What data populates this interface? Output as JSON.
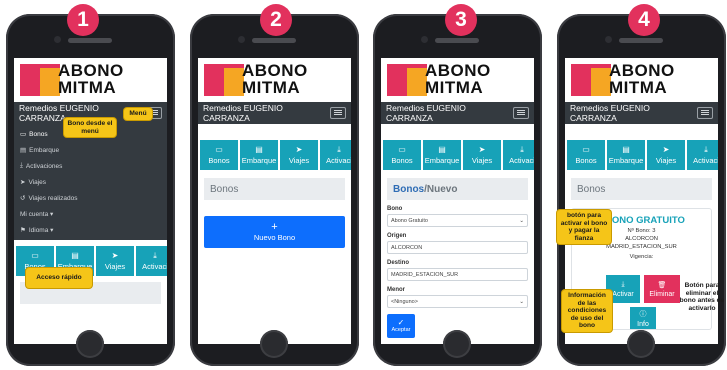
{
  "steps": [
    "1",
    "2",
    "3",
    "4"
  ],
  "app": {
    "logo_line1": "ABONO",
    "logo_line2": "MITMA",
    "user": "Remedios EUGENIO CARRANZA"
  },
  "tiles": [
    {
      "label": "Bonos",
      "icon": "card-icon"
    },
    {
      "label": "Embarque",
      "icon": "clipboard-icon"
    },
    {
      "label": "Viajes",
      "icon": "send-icon"
    },
    {
      "label": "Activaci",
      "icon": "download-icon"
    }
  ],
  "screen1": {
    "menu": [
      "Bonos",
      "Embarque",
      "Activaciones",
      "Viajes",
      "Viajes realizados",
      "Mi cuenta ▾",
      "Idioma ▾"
    ],
    "callout_menu_item": "Bono desde el menú",
    "callout_menu": "Menú",
    "callout_quick": "Acceso rápido"
  },
  "screen2": {
    "title": "Bonos",
    "new_button": "Nuevo Bono",
    "plus": "+"
  },
  "screen3": {
    "title_main": "Bonos",
    "title_sep": " / ",
    "title_sub": "Nuevo",
    "fields": [
      {
        "label": "Bono",
        "value": "Abono Gratuito",
        "select": true
      },
      {
        "label": "Origen",
        "value": "ALCORCON",
        "select": false
      },
      {
        "label": "Destino",
        "value": "MADRID_ESTACION_SUR",
        "select": false
      },
      {
        "label": "Menor",
        "value": "<Ninguno>",
        "select": true
      }
    ],
    "accept": "Aceptar",
    "check": "✓"
  },
  "screen4": {
    "title": "Bonos",
    "card_title": "ABONO GRATUITO",
    "bono_num": "Nº Bono: 3",
    "origin": "ALCORCON",
    "destination": "MADRID_ESTACION_SUR",
    "validity": "Vigencia:",
    "activate": "Activar",
    "delete": "Eliminar",
    "info": "Info",
    "callout_activate": "botón para activar el bono y pagar la fianza",
    "callout_delete": "Botón para eliminar el bono antes de activarlo",
    "callout_info": "Información de las condiciones de uso del bono"
  },
  "colors": {
    "badge": "#e2315d",
    "tile": "#17a2b8",
    "primary": "#0d6efd",
    "danger": "#e2315d",
    "callout": "#f5c518",
    "navbar": "#343a40"
  }
}
